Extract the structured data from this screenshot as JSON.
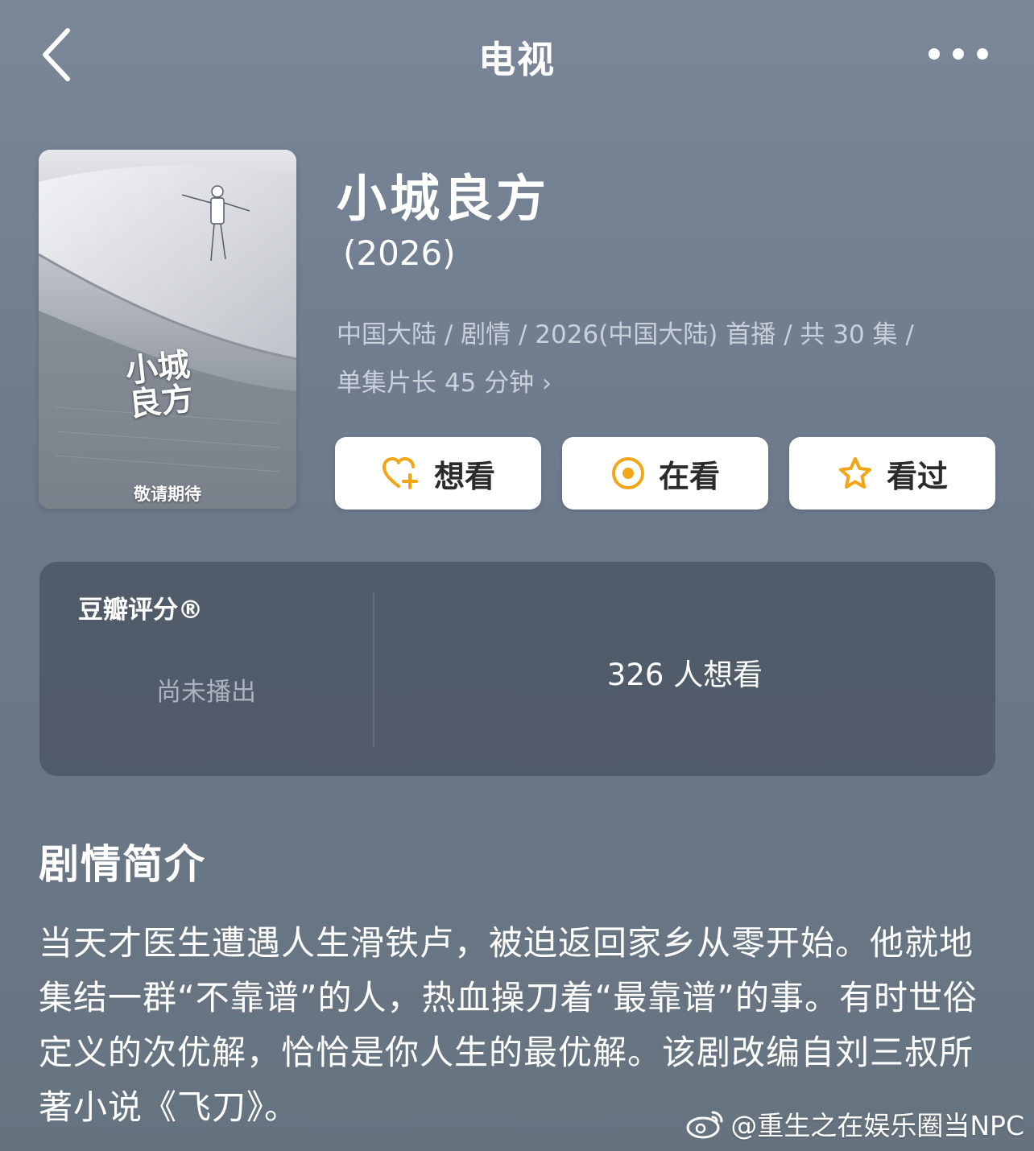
{
  "nav": {
    "title": "电视",
    "back_icon": "chevron-left-icon",
    "more_icon": "more-horizontal-icon"
  },
  "poster": {
    "title_art": "小城良方",
    "caption": "敬请期待"
  },
  "show": {
    "title": "小城良方",
    "year": "(2026)",
    "meta_line1": "中国大陆 / 剧情 / 2026(中国大陆) 首播 / 共 30 集 /",
    "meta_line2": "单集片长 45 分钟",
    "meta_chevron": "›"
  },
  "actions": [
    {
      "label": "想看",
      "icon": "heart-plus-icon"
    },
    {
      "label": "在看",
      "icon": "target-icon"
    },
    {
      "label": "看过",
      "icon": "star-outline-icon"
    }
  ],
  "rating": {
    "label": "豆瓣评分®",
    "status": "尚未播出",
    "want_count": "326 人想看"
  },
  "synopsis": {
    "title": "剧情简介",
    "text": "当天才医生遭遇人生滑铁卢，被迫返回家乡从零开始。他就地集结一群“不靠谱”的人，热血操刀着“最靠谱”的事。有时世俗定义的次优解，恰恰是你人生的最优解。该剧改编自刘三叔所著小说《飞刀》。"
  },
  "watermark": {
    "text": "@重生之在娱乐圈当NPC",
    "icon": "weibo-logo-icon"
  },
  "colors": {
    "background": "#74818f",
    "accent": "#f2a516",
    "card": "#4f5b68"
  }
}
